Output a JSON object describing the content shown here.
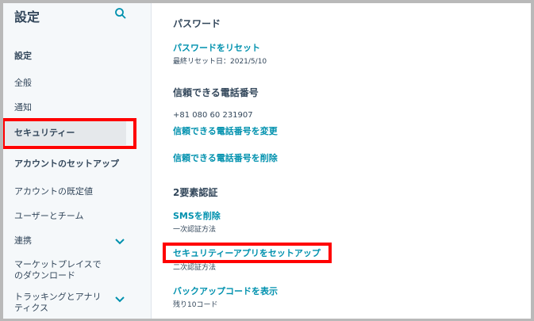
{
  "sidebar": {
    "title": "設定",
    "items": [
      {
        "label": "設定"
      },
      {
        "label": "全般"
      },
      {
        "label": "通知"
      },
      {
        "label": "セキュリティー"
      },
      {
        "label": "アカウントのセットアップ"
      },
      {
        "label": "アカウントの既定値"
      },
      {
        "label": "ユーザーとチーム"
      },
      {
        "label": "連携"
      },
      {
        "label": "マーケットプレイスでのダウンロード"
      },
      {
        "label": "トラッキングとアナリティクス"
      }
    ],
    "icons": {
      "search": "search-icon",
      "chevron": "chevron-down-icon"
    }
  },
  "main": {
    "password": {
      "heading": "パスワード",
      "reset_link": "パスワードをリセット",
      "last_reset": "最終リセット日：2021/5/10"
    },
    "phone": {
      "heading": "信頼できる電話番号",
      "number": "+81 080 60 231907",
      "change_link": "信頼できる電話番号を変更",
      "delete_link": "信頼できる電話番号を削除"
    },
    "twofa": {
      "heading": "2要素認証",
      "sms_link": "SMSを削除",
      "sms_sub": "一次認証方法",
      "app_link": "セキュリティーアプリをセットアップ",
      "app_sub": "二次認証方法",
      "backup_link": "バックアップコードを表示",
      "backup_sub": "残り10コード"
    }
  },
  "colors": {
    "accent": "#0091ae",
    "highlight": "#ff0000",
    "text": "#33475b"
  }
}
